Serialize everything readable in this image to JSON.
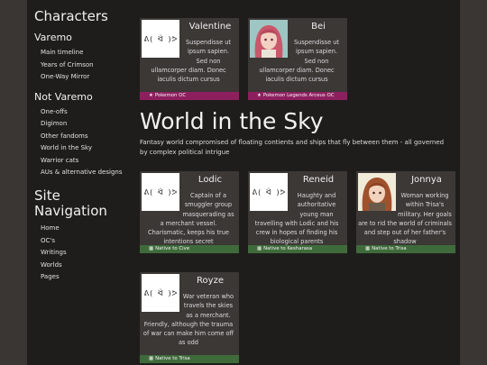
{
  "sidebar": {
    "title": "Characters",
    "groups": [
      {
        "heading": "Varemo",
        "items": [
          "Main timeline",
          "Years of Crimson",
          "One-Way Mirror"
        ]
      },
      {
        "heading": "Not Varemo",
        "items": [
          "One-offs",
          "Digimon",
          "Other fandoms",
          "World in the Sky",
          "Warrior cats",
          "AUs & alternative designs"
        ]
      }
    ],
    "nav_title": "Site Navigation",
    "nav_items": [
      "Home",
      "OC's",
      "Writings",
      "Worlds",
      "Pages"
    ]
  },
  "top_cards": [
    {
      "name": "Valentine",
      "avatar_text": "ᕕ( ᐛ )ᕗ",
      "desc": "Suspendisse ut ipsum sapien. Sed non ullamcorper diam. Donec iaculis dictum cursus",
      "tag": "Pokemon OC",
      "tag_color": "#8e1f5f"
    },
    {
      "name": "Bei",
      "avatar_text": "",
      "desc": "Suspendisse ut ipsum sapien. Sed non ullamcorper diam. Donec iaculis dictum cursus",
      "tag": "Pokemon Legends Arceus OC",
      "tag_color": "#8e1f5f"
    }
  ],
  "section": {
    "title": "World in the Sky",
    "desc": "Fantasy world compromised of floating contients and ships that fly between them - all governed by complex political intrigue"
  },
  "world_cards": [
    {
      "name": "Lodic",
      "avatar_text": "ᕕ( ᐛ )ᕗ",
      "desc": "Captain of a smuggler group masquerading as a merchant vessel. Charismatic, keeps his true intentions secret",
      "tag": "Native to Cive",
      "tag_color": "#3f6b3b"
    },
    {
      "name": "Reneid",
      "avatar_text": "ᕕ( ᐛ )ᕗ",
      "desc": "Haughty and authoritative young man travelling with Lodic and his crew in hopes of finding his biological parents",
      "tag": "Native to Kesharasa",
      "tag_color": "#3f6b3b"
    },
    {
      "name": "Jonnya",
      "avatar_text": "",
      "desc": "Woman working within Trisa's military. Her goals are to rid the world of criminals and step out of her father's shadow",
      "tag": "Native to Trisa",
      "tag_color": "#3f6b3b"
    },
    {
      "name": "Royze",
      "avatar_text": "ᕕ( ᐛ )ᕗ",
      "desc": "War veteran who travels the skies as a merchant. Friendly, although the trauma of war can make him come off as odd",
      "tag": "Native to Trisa",
      "tag_color": "#3f6b3b"
    }
  ]
}
